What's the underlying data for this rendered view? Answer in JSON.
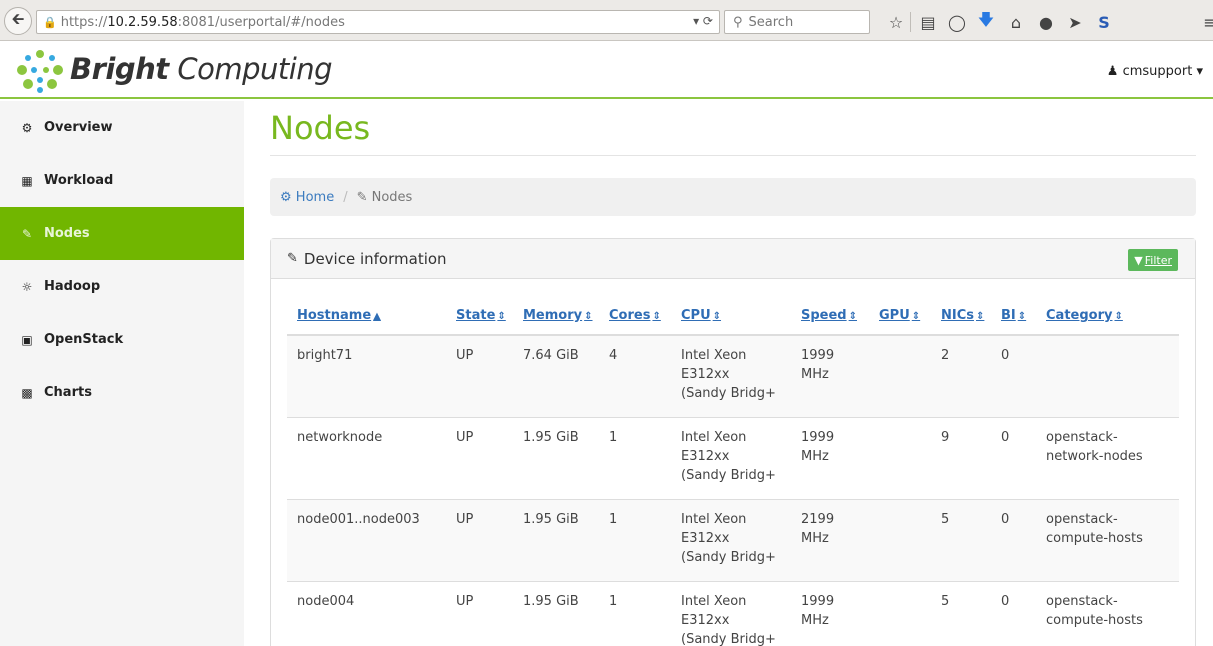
{
  "browser": {
    "url_prefix": "https://",
    "url_host": "10.2.59.58",
    "url_rest": ":8081/userportal/#/nodes",
    "search_placeholder": "Search"
  },
  "header": {
    "brand_bold": "Bright",
    "brand_light": " Computing",
    "user": "cmsupport"
  },
  "sidebar": {
    "items": [
      {
        "label": "Overview",
        "icon": "dashboard-icon",
        "active": false
      },
      {
        "label": "Workload",
        "icon": "table-icon",
        "active": false
      },
      {
        "label": "Nodes",
        "icon": "edit-icon",
        "active": true
      },
      {
        "label": "Hadoop",
        "icon": "hadoop-icon",
        "active": false
      },
      {
        "label": "OpenStack",
        "icon": "openstack-icon",
        "active": false
      },
      {
        "label": "Charts",
        "icon": "bar-chart-icon",
        "active": false
      }
    ]
  },
  "main": {
    "title": "Nodes",
    "breadcrumb": {
      "home": "Home",
      "current": "Nodes"
    },
    "panel": {
      "title": "Device information",
      "filter_label": "Filter"
    },
    "table": {
      "columns": [
        "Hostname",
        "State",
        "Memory",
        "Cores",
        "CPU",
        "Speed",
        "GPU",
        "NICs",
        "BI",
        "Category"
      ],
      "rows": [
        {
          "hostname": "bright71",
          "state": "UP",
          "memory": "7.64 GiB",
          "cores": "4",
          "cpu1": "Intel Xeon",
          "cpu2": "E312xx",
          "cpu3": "(Sandy Bridg+",
          "speed1": "1999",
          "speed2": "MHz",
          "gpu": "",
          "nics": "2",
          "bi": "0",
          "cat1": "",
          "cat2": ""
        },
        {
          "hostname": "networknode",
          "state": "UP",
          "memory": "1.95 GiB",
          "cores": "1",
          "cpu1": "Intel Xeon",
          "cpu2": "E312xx",
          "cpu3": "(Sandy Bridg+",
          "speed1": "1999",
          "speed2": "MHz",
          "gpu": "",
          "nics": "9",
          "bi": "0",
          "cat1": "openstack-",
          "cat2": "network-nodes"
        },
        {
          "hostname": "node001..node003",
          "state": "UP",
          "memory": "1.95 GiB",
          "cores": "1",
          "cpu1": "Intel Xeon",
          "cpu2": "E312xx",
          "cpu3": "(Sandy Bridg+",
          "speed1": "2199",
          "speed2": "MHz",
          "gpu": "",
          "nics": "5",
          "bi": "0",
          "cat1": "openstack-",
          "cat2": "compute-hosts"
        },
        {
          "hostname": "node004",
          "state": "UP",
          "memory": "1.95 GiB",
          "cores": "1",
          "cpu1": "Intel Xeon",
          "cpu2": "E312xx",
          "cpu3": "(Sandy Bridg+",
          "speed1": "1999",
          "speed2": "MHz",
          "gpu": "",
          "nics": "5",
          "bi": "0",
          "cat1": "openstack-",
          "cat2": "compute-hosts"
        }
      ]
    }
  },
  "colors": {
    "brand_green": "#71b600",
    "title_green": "#78b81f",
    "link_blue": "#2f6db5",
    "filter_green": "#5cb85c"
  }
}
